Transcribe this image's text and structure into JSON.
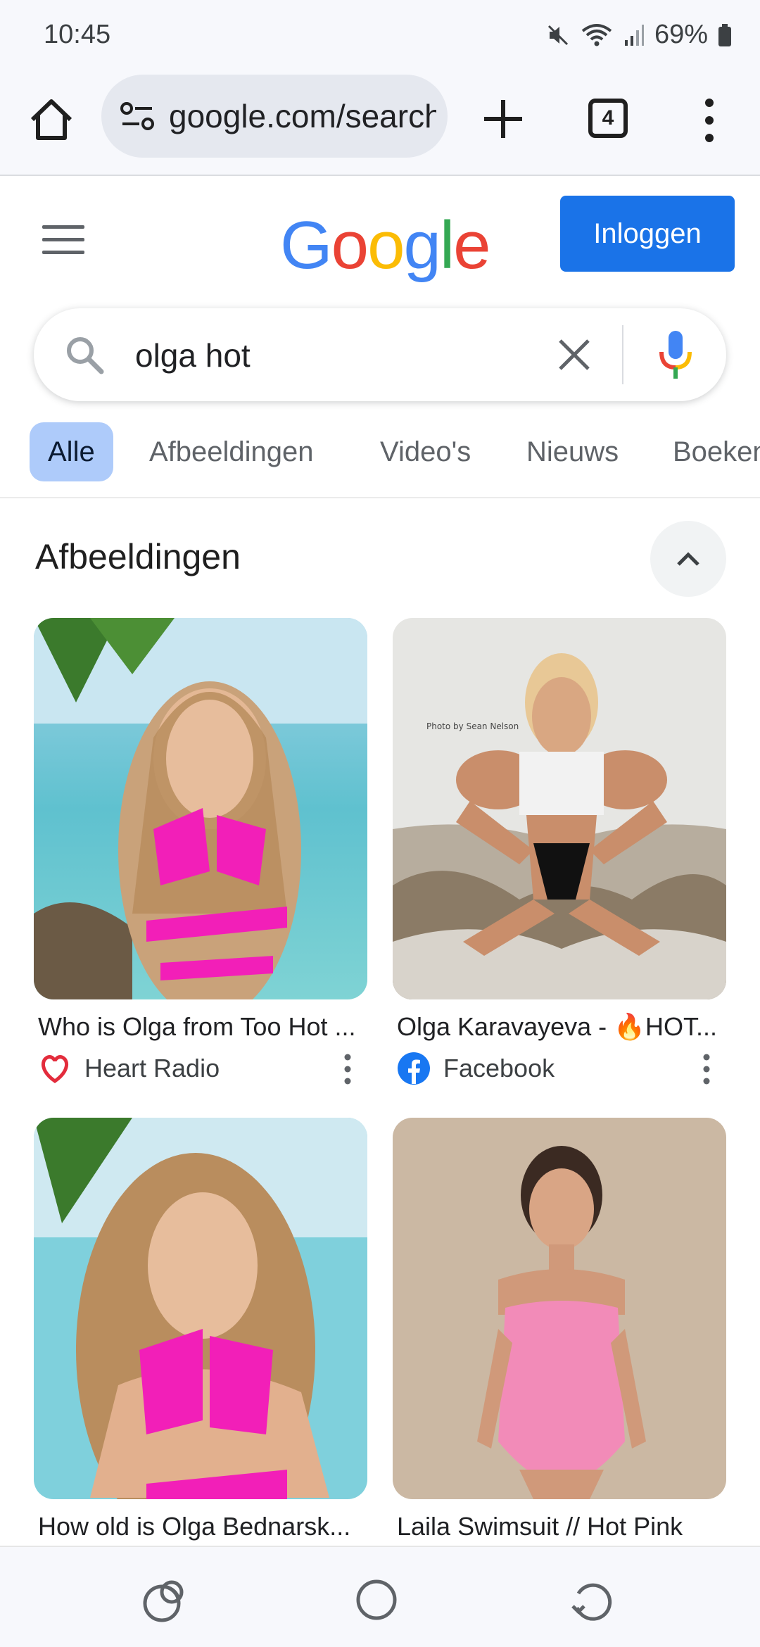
{
  "status_bar": {
    "time": "10:45",
    "battery": "69%"
  },
  "toolbar": {
    "url": "google.com/search",
    "tab_count": "4"
  },
  "header": {
    "logo": [
      "G",
      "o",
      "o",
      "g",
      "l",
      "e"
    ],
    "signin_label": "Inloggen"
  },
  "search": {
    "query": "olga hot"
  },
  "tabs": [
    {
      "label": "Alle",
      "active": true
    },
    {
      "label": "Afbeeldingen",
      "active": false
    },
    {
      "label": "Video's",
      "active": false
    },
    {
      "label": "Nieuws",
      "active": false
    },
    {
      "label": "Boeken",
      "active": false
    }
  ],
  "images_section": {
    "title": "Afbeeldingen",
    "results": [
      {
        "title": "Who is Olga from Too Hot ...",
        "source": "Heart Radio",
        "source_icon": "heart-radio-icon"
      },
      {
        "title": "Olga Karavayeva - 🔥HOT...",
        "source": "Facebook",
        "source_icon": "facebook-icon",
        "watermark": "Photo by Sean Nelson"
      },
      {
        "title": "How old is Olga Bednarsk...",
        "source": "",
        "source_icon": ""
      },
      {
        "title": "Laila Swimsuit // Hot Pink",
        "source": "",
        "source_icon": ""
      }
    ]
  },
  "colors": {
    "accent": "#1a73e8",
    "active_tab": "#aecbfa",
    "google_blue": "#4285f4",
    "google_red": "#ea4335",
    "google_yellow": "#fbbc05",
    "google_green": "#34a853"
  }
}
